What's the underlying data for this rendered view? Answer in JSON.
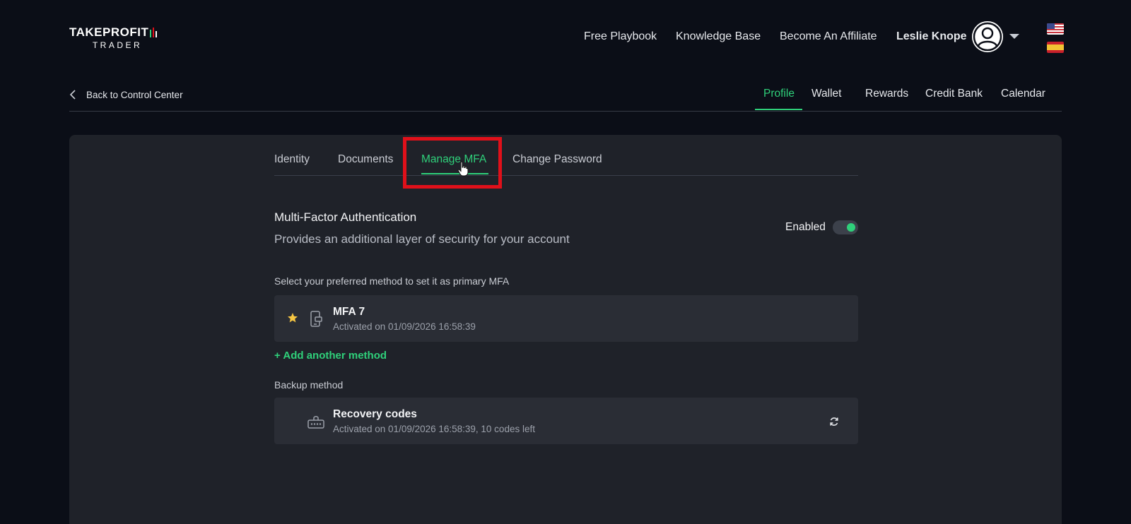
{
  "header": {
    "logo_word_bold": "TAKEPROFIT",
    "logo_word_sub": "TRADER",
    "nav": [
      {
        "label": "Free Playbook"
      },
      {
        "label": "Knowledge Base"
      },
      {
        "label": "Become An Affiliate"
      }
    ],
    "user_name": "Leslie Knope",
    "avatar_icon": "user-circle-icon",
    "languages": [
      "flag-us",
      "flag-es"
    ]
  },
  "subbar": {
    "back_label": "Back to Control Center",
    "tabs": [
      {
        "label": "Profile",
        "active": true
      },
      {
        "label": "Wallet"
      },
      {
        "label": "Rewards"
      },
      {
        "label": "Credit Bank"
      },
      {
        "label": "Calendar"
      }
    ]
  },
  "profile_tabs": [
    {
      "label": "Identity"
    },
    {
      "label": "Documents"
    },
    {
      "label": "Manage MFA",
      "active": true
    },
    {
      "label": "Change Password"
    }
  ],
  "mfa": {
    "title": "Multi-Factor Authentication",
    "subtitle": "Provides an additional layer of security for your account",
    "status_label": "Enabled",
    "enabled": true,
    "select_label": "Select your preferred method to set it as primary MFA",
    "primary": {
      "name": "MFA 7",
      "activated": "Activated on 01/09/2026 16:58:39"
    },
    "add_method_label": "+ Add another method",
    "backup_label": "Backup method",
    "backup": {
      "name": "Recovery codes",
      "activated": "Activated on 01/09/2026 16:58:39, 10 codes left"
    }
  },
  "colors": {
    "accent": "#2fd07a",
    "background": "#0b0e17",
    "panel": "#1f2229",
    "card": "#2a2d35",
    "highlight": "#e0101a",
    "star": "#f5c542"
  }
}
